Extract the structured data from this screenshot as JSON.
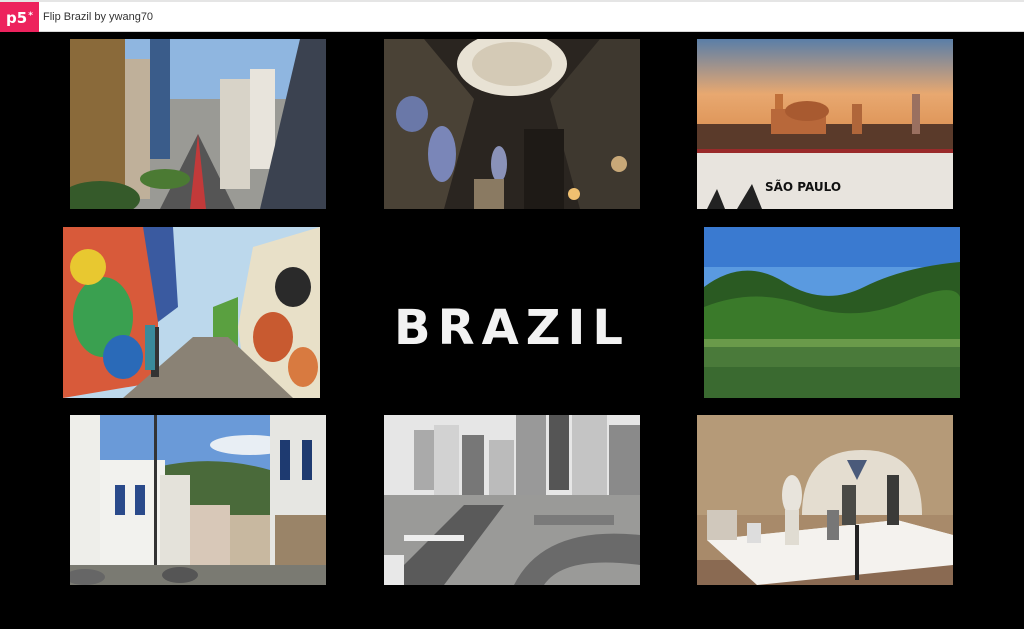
{
  "app": {
    "logo_text": "p5",
    "logo_mark": "*",
    "sketch_title": "Flip Brazil by ywang70"
  },
  "center_title": "BRAZIL",
  "photos": [
    {
      "name": "city-avenue-photo"
    },
    {
      "name": "cathedral-interior-photo"
    },
    {
      "name": "sao-paulo-skyline-photo",
      "sign_text": "SÃO PAULO"
    },
    {
      "name": "graffiti-alley-photo"
    },
    {
      "name": "tropical-lake-photo"
    },
    {
      "name": "colonial-town-photo"
    },
    {
      "name": "highway-interchange-photo"
    },
    {
      "name": "sculpture-gallery-photo"
    }
  ]
}
